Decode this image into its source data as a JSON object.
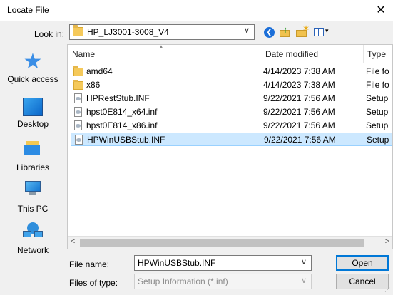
{
  "window": {
    "title": "Locate File",
    "close_glyph": "✕"
  },
  "lookin": {
    "label": "Look in:",
    "value": "HP_LJ3001-3008_V4",
    "dropdown_icon": "chevron-down-icon"
  },
  "toolbar": {
    "icons": [
      "back-icon",
      "up-folder-icon",
      "new-folder-icon",
      "view-menu-icon"
    ],
    "view_menu_glyph": "▾"
  },
  "places": [
    {
      "label": "Quick access",
      "icon": "quick-access-icon"
    },
    {
      "label": "Desktop",
      "icon": "desktop-icon"
    },
    {
      "label": "Libraries",
      "icon": "libraries-icon"
    },
    {
      "label": "This PC",
      "icon": "this-pc-icon"
    },
    {
      "label": "Network",
      "icon": "network-icon"
    }
  ],
  "files": {
    "columns": [
      "Name",
      "Date modified",
      "Type"
    ],
    "rows": [
      {
        "icon": "folder",
        "name": "amd64",
        "date": "4/14/2023 7:38 AM",
        "type": "File fo"
      },
      {
        "icon": "folder",
        "name": "x86",
        "date": "4/14/2023 7:38 AM",
        "type": "File fo"
      },
      {
        "icon": "file",
        "name": "HPRestStub.INF",
        "date": "9/22/2021 7:56 AM",
        "type": "Setup"
      },
      {
        "icon": "file",
        "name": "hpst0E814_x64.inf",
        "date": "9/22/2021 7:56 AM",
        "type": "Setup"
      },
      {
        "icon": "file",
        "name": "hpst0E814_x86.inf",
        "date": "9/22/2021 7:56 AM",
        "type": "Setup"
      },
      {
        "icon": "file",
        "name": "HPWinUSBStub.INF",
        "date": "9/22/2021 7:56 AM",
        "type": "Setup",
        "selected": true
      }
    ]
  },
  "scrollbar": {
    "left_glyph": "<",
    "right_glyph": ">"
  },
  "filename": {
    "label": "File name:",
    "value": "HPWinUSBStub.INF"
  },
  "filetype": {
    "label": "Files of type:",
    "value": "Setup Information (*.inf)"
  },
  "buttons": {
    "open": "Open",
    "cancel": "Cancel"
  },
  "colors": {
    "selection": "#cce8ff",
    "accent": "#0078d7"
  }
}
